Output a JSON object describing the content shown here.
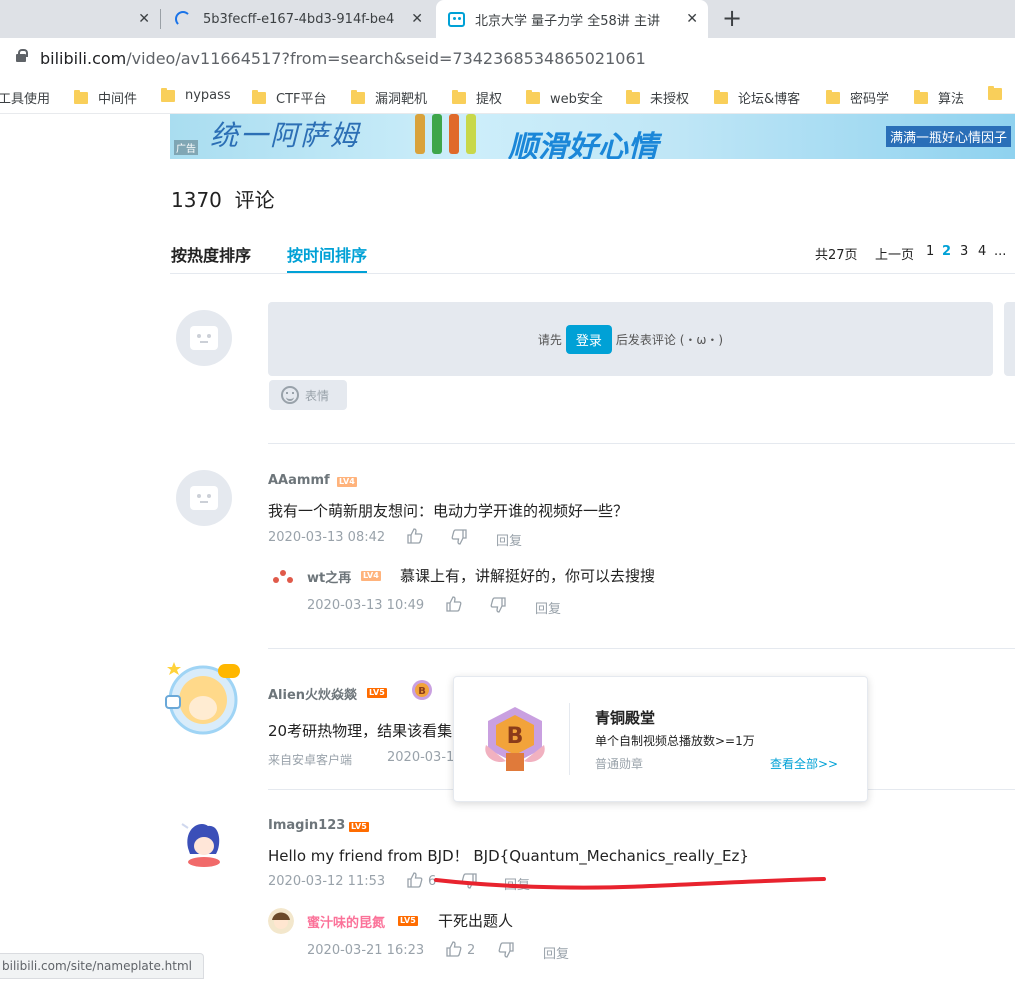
{
  "browser": {
    "tabs": [
      {
        "title": "",
        "close": "✕"
      },
      {
        "title": "5b3fecff-e167-4bd3-914f-be4",
        "close": "✕"
      },
      {
        "title": "北京大学 量子力学 全58讲 主讲",
        "close": "✕"
      }
    ],
    "new_tab": "+",
    "url_host": "bilibili.com",
    "url_rest": "/video/av11664517?from=search&seid=7342368534865021061",
    "bookmarks": [
      "工具使用",
      "中间件",
      "nypass",
      "CTF平台",
      "漏洞靶机",
      "提权",
      "web安全",
      "未授权",
      "论坛&博客",
      "密码学",
      "算法"
    ],
    "status_url": "bilibili.com/site/nameplate.html"
  },
  "ad": {
    "tag": "广告",
    "text_left": "统一阿萨姆",
    "text_mid": "顺滑好心情",
    "text_right": "满满一瓶好心情因子"
  },
  "comments_header": {
    "count": "1370",
    "label": "评论",
    "sort_hot": "按热度排序",
    "sort_time": "按时间排序",
    "pager": {
      "total": "共27页",
      "prev": "上一页",
      "pages": [
        "1",
        "2",
        "3",
        "4",
        "..."
      ],
      "current": "2"
    }
  },
  "compose": {
    "prefix": "请先",
    "login": "登录",
    "suffix": "后发表评论 (・ω・)",
    "emoji_label": "表情"
  },
  "comments": [
    {
      "user": "AAammf",
      "level": "LV4",
      "text": "我有一个萌新朋友想问：电动力学开谁的视频好一些？",
      "time": "2020-03-13 08:42",
      "likes": "",
      "reply": "回复",
      "replies": [
        {
          "user": "wt之再",
          "level": "LV4",
          "text": "慕课上有，讲解挺好的，你可以去搜搜",
          "time": "2020-03-13 10:49",
          "likes": "",
          "reply": "回复"
        }
      ]
    },
    {
      "user": "Alien火炏焱燚",
      "level": "LV5",
      "text": "20考研热物理，结果该看集",
      "source": "来自安卓客户端",
      "time": "2020-03-1"
    },
    {
      "user": "Imagin123",
      "level": "LV5",
      "text": "Hello my friend from BJD！  BJD{Quantum_Mechanics_really_Ez}",
      "time": "2020-03-12 11:53",
      "likes": "6",
      "reply": "回复",
      "replies": [
        {
          "user": "蜜汁味的昆氮",
          "level": "LV5",
          "text": "干死出题人",
          "time": "2020-03-21 16:23",
          "likes": "2",
          "reply": "回复"
        }
      ]
    }
  ],
  "badge_popup": {
    "title": "青铜殿堂",
    "desc": "单个自制视频总播放数>=1万",
    "type": "普通勋章",
    "link": "查看全部>>",
    "badge_letter": "B"
  },
  "colors": {
    "accent": "#00a1d6",
    "annotation": "#e8232e",
    "lv5": "#ff6c00",
    "lv4": "#ffb37c"
  }
}
